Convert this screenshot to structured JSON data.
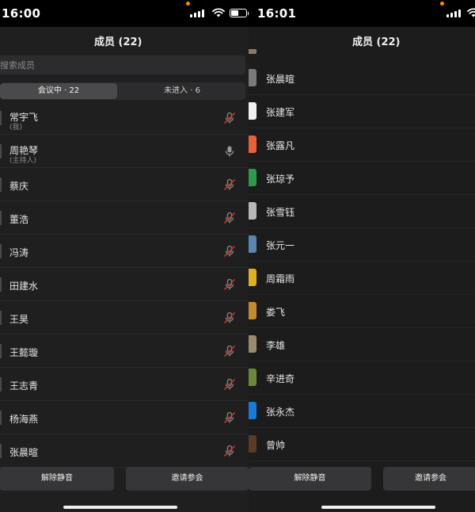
{
  "left": {
    "status": {
      "time": "16:00"
    },
    "title": "成员 (22)",
    "search": {
      "placeholder": "搜索成员"
    },
    "tabs": [
      {
        "label": "会议中 · 22",
        "active": true
      },
      {
        "label": "未进入 · 6",
        "active": false
      }
    ],
    "participants": [
      {
        "name": "常宇飞",
        "role": "(我)",
        "mic": "muted"
      },
      {
        "name": "周艳琴",
        "role": "(主持人)",
        "mic": "on"
      },
      {
        "name": "蔡庆",
        "role": "",
        "mic": "muted"
      },
      {
        "name": "董浩",
        "role": "",
        "mic": "muted"
      },
      {
        "name": "冯涛",
        "role": "",
        "mic": "muted"
      },
      {
        "name": "田建水",
        "role": "",
        "mic": "muted"
      },
      {
        "name": "王昊",
        "role": "",
        "mic": "muted"
      },
      {
        "name": "王懿璇",
        "role": "",
        "mic": "muted"
      },
      {
        "name": "王志青",
        "role": "",
        "mic": "muted"
      },
      {
        "name": "杨海燕",
        "role": "",
        "mic": "muted"
      },
      {
        "name": "张晨暄",
        "role": "",
        "mic": "muted"
      }
    ],
    "buttons": {
      "unmute": "解除静音",
      "invite": "邀请参会"
    }
  },
  "right": {
    "status": {
      "time": "16:01"
    },
    "title": "成员 (22)",
    "members": [
      {
        "name": "张晨暄",
        "avatar_color": "#7a7a7a"
      },
      {
        "name": "张建军",
        "avatar_color": "#f2f2f2"
      },
      {
        "name": "张露凡",
        "avatar_color": "#e8613a"
      },
      {
        "name": "张琼予",
        "avatar_color": "#2e9a4e"
      },
      {
        "name": "张雪钰",
        "avatar_color": "#b8b8b8"
      },
      {
        "name": "张元一",
        "avatar_color": "#5a86b0"
      },
      {
        "name": "周霜雨",
        "avatar_color": "#e0b020"
      },
      {
        "name": "娄飞",
        "avatar_color": "#c48a30"
      },
      {
        "name": "李雄",
        "avatar_color": "#9a8a70"
      },
      {
        "name": "辛进奇",
        "avatar_color": "#6a8a3a"
      },
      {
        "name": "张永杰",
        "avatar_color": "#1a7ad8"
      },
      {
        "name": "曾帅",
        "avatar_color": "#5a3a28"
      }
    ],
    "buttons": {
      "unmute": "解除静音",
      "invite": "邀请参会"
    }
  },
  "colors": {
    "background": "#1f1f1f",
    "muted_red": "#c0392b",
    "button": "#363638"
  }
}
